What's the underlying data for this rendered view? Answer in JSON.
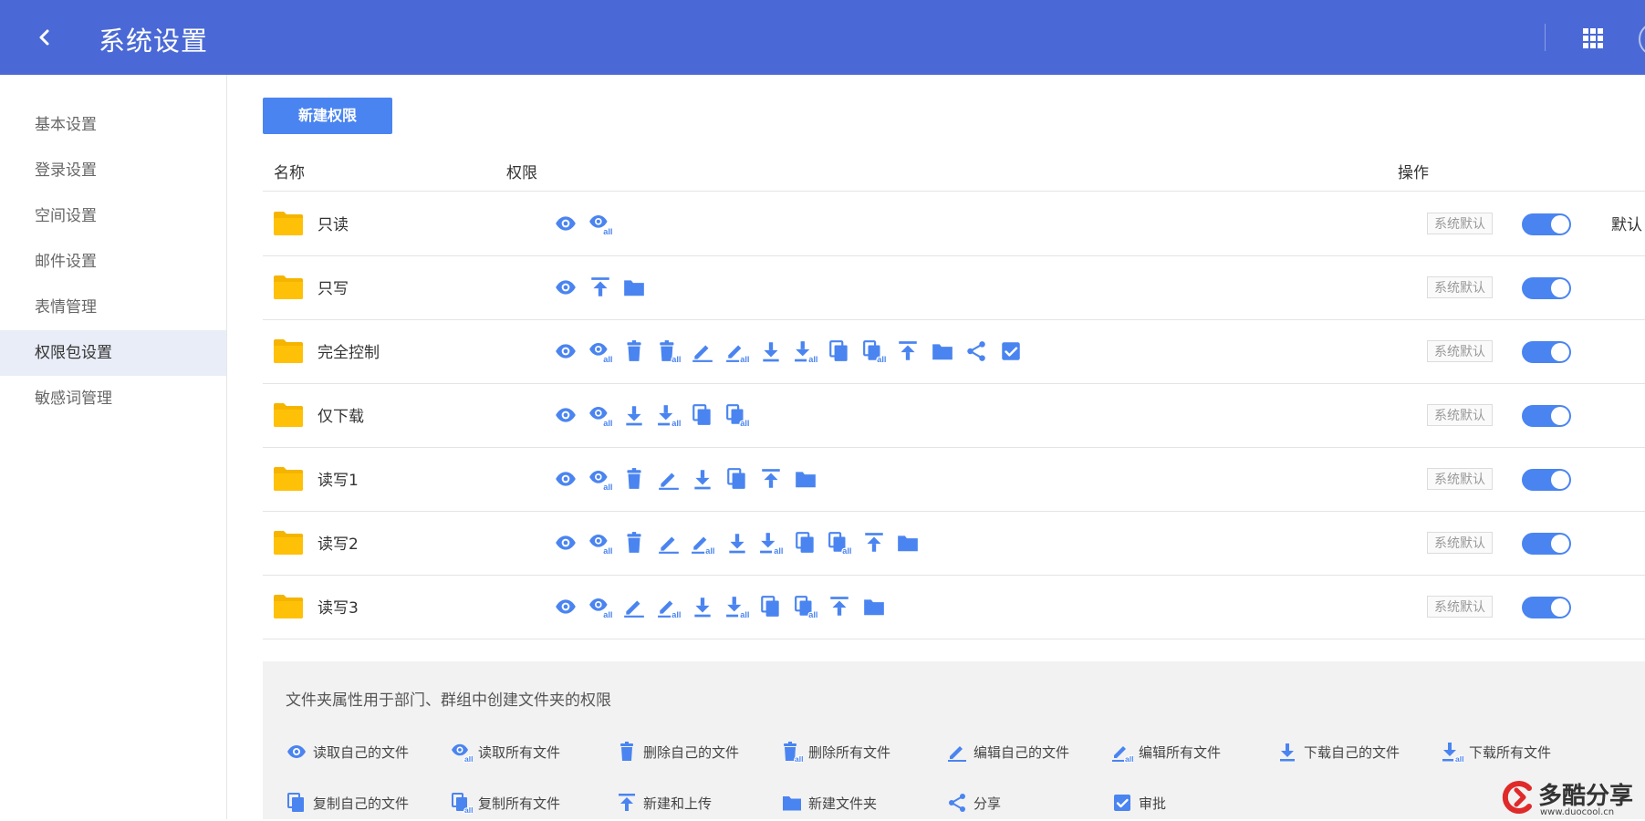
{
  "header": {
    "title": "系统设置",
    "back_icon": "chevron-left-icon",
    "apps_icon": "grid-icon",
    "background": "#4a69d6"
  },
  "sidebar": {
    "items": [
      {
        "label": "基本设置"
      },
      {
        "label": "登录设置"
      },
      {
        "label": "空间设置"
      },
      {
        "label": "邮件设置"
      },
      {
        "label": "表情管理"
      },
      {
        "label": "权限包设置",
        "active": true
      },
      {
        "label": "敏感词管理"
      }
    ]
  },
  "toolbar": {
    "new_button": "新建权限",
    "accent": "#4a84f0"
  },
  "table": {
    "headers": {
      "name": "名称",
      "permissions": "权限",
      "actions": "操作"
    },
    "rows": [
      {
        "name": "只读",
        "badge": "系统默认",
        "enabled": true,
        "extra": "默认",
        "perms": [
          "read-own",
          "read-all"
        ]
      },
      {
        "name": "只写",
        "badge": "系统默认",
        "enabled": true,
        "perms": [
          "read-own",
          "upload",
          "new-folder"
        ]
      },
      {
        "name": "完全控制",
        "badge": "系统默认",
        "enabled": true,
        "perms": [
          "read-own",
          "read-all",
          "delete-own",
          "delete-all",
          "edit-own",
          "edit-all",
          "download-own",
          "download-all",
          "copy-own",
          "copy-all",
          "upload",
          "new-folder",
          "share",
          "approve"
        ]
      },
      {
        "name": "仅下载",
        "badge": "系统默认",
        "enabled": true,
        "perms": [
          "read-own",
          "read-all",
          "download-own",
          "download-all",
          "copy-own",
          "copy-all"
        ]
      },
      {
        "name": "读写1",
        "badge": "系统默认",
        "enabled": true,
        "perms": [
          "read-own",
          "read-all",
          "delete-own",
          "edit-own",
          "download-own",
          "copy-own",
          "upload",
          "new-folder"
        ]
      },
      {
        "name": "读写2",
        "badge": "系统默认",
        "enabled": true,
        "perms": [
          "read-own",
          "read-all",
          "delete-own",
          "edit-own",
          "edit-all",
          "download-own",
          "download-all",
          "copy-own",
          "copy-all",
          "upload",
          "new-folder"
        ]
      },
      {
        "name": "读写3",
        "badge": "系统默认",
        "enabled": true,
        "perms": [
          "read-own",
          "read-all",
          "edit-own",
          "edit-all",
          "download-own",
          "download-all",
          "copy-own",
          "copy-all",
          "upload",
          "new-folder"
        ]
      }
    ]
  },
  "legend": {
    "note": "文件夹属性用于部门、群组中创建文件夹的权限",
    "items": [
      {
        "icon": "read-own",
        "label": "读取自己的文件"
      },
      {
        "icon": "read-all",
        "label": "读取所有文件"
      },
      {
        "icon": "delete-own",
        "label": "删除自己的文件"
      },
      {
        "icon": "delete-all",
        "label": "删除所有文件"
      },
      {
        "icon": "edit-own",
        "label": "编辑自己的文件"
      },
      {
        "icon": "edit-all",
        "label": "编辑所有文件"
      },
      {
        "icon": "download-own",
        "label": "下载自己的文件"
      },
      {
        "icon": "download-all",
        "label": "下载所有文件"
      },
      {
        "icon": "copy-own",
        "label": "复制自己的文件"
      },
      {
        "icon": "copy-all",
        "label": "复制所有文件"
      },
      {
        "icon": "upload",
        "label": "新建和上传"
      },
      {
        "icon": "new-folder",
        "label": "新建文件夹"
      },
      {
        "icon": "share",
        "label": "分享"
      },
      {
        "icon": "approve",
        "label": "审批"
      }
    ]
  },
  "watermark": {
    "text": "多酷分享",
    "url": "www.duocool.cn"
  }
}
